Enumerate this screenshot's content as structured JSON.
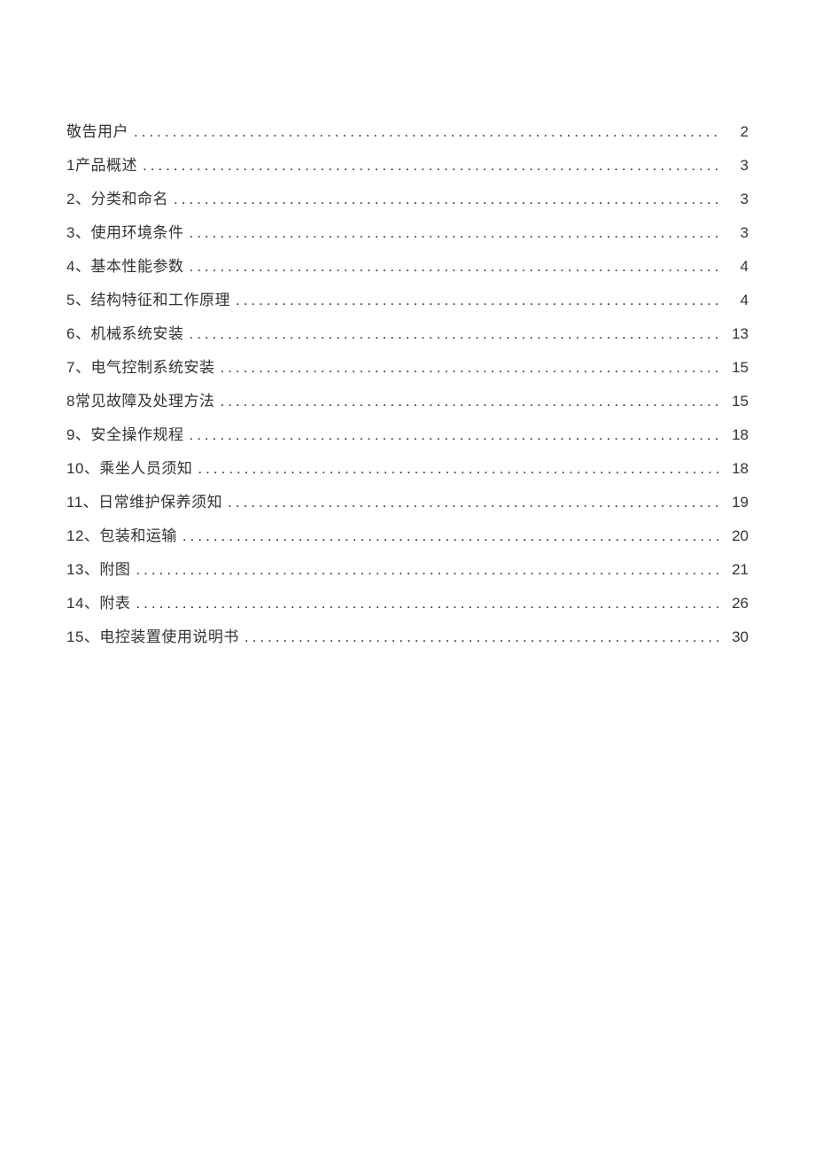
{
  "toc": {
    "entries": [
      {
        "title": "敬告用户",
        "page": "2"
      },
      {
        "title": "1产品概述",
        "page": "3"
      },
      {
        "title": "2、分类和命名",
        "page": "3"
      },
      {
        "title": "3、使用环境条件",
        "page": "3"
      },
      {
        "title": "4、基本性能参数",
        "page": "4"
      },
      {
        "title": "5、结构特征和工作原理",
        "page": "4"
      },
      {
        "title": "6、机械系统安装",
        "page": "13"
      },
      {
        "title": "7、电气控制系统安装",
        "page": "15"
      },
      {
        "title": "8常见故障及处理方法",
        "page": "15"
      },
      {
        "title": "9、安全操作规程",
        "page": "18"
      },
      {
        "title": "10、乘坐人员须知",
        "page": "18"
      },
      {
        "title": "11、日常维护保养须知",
        "page": "19"
      },
      {
        "title": "12、包装和运输",
        "page": "20"
      },
      {
        "title": "13、附图",
        "page": "21"
      },
      {
        "title": "14、附表",
        "page": "26"
      },
      {
        "title": "15、电控装置使用说明书",
        "page": "30"
      }
    ]
  }
}
